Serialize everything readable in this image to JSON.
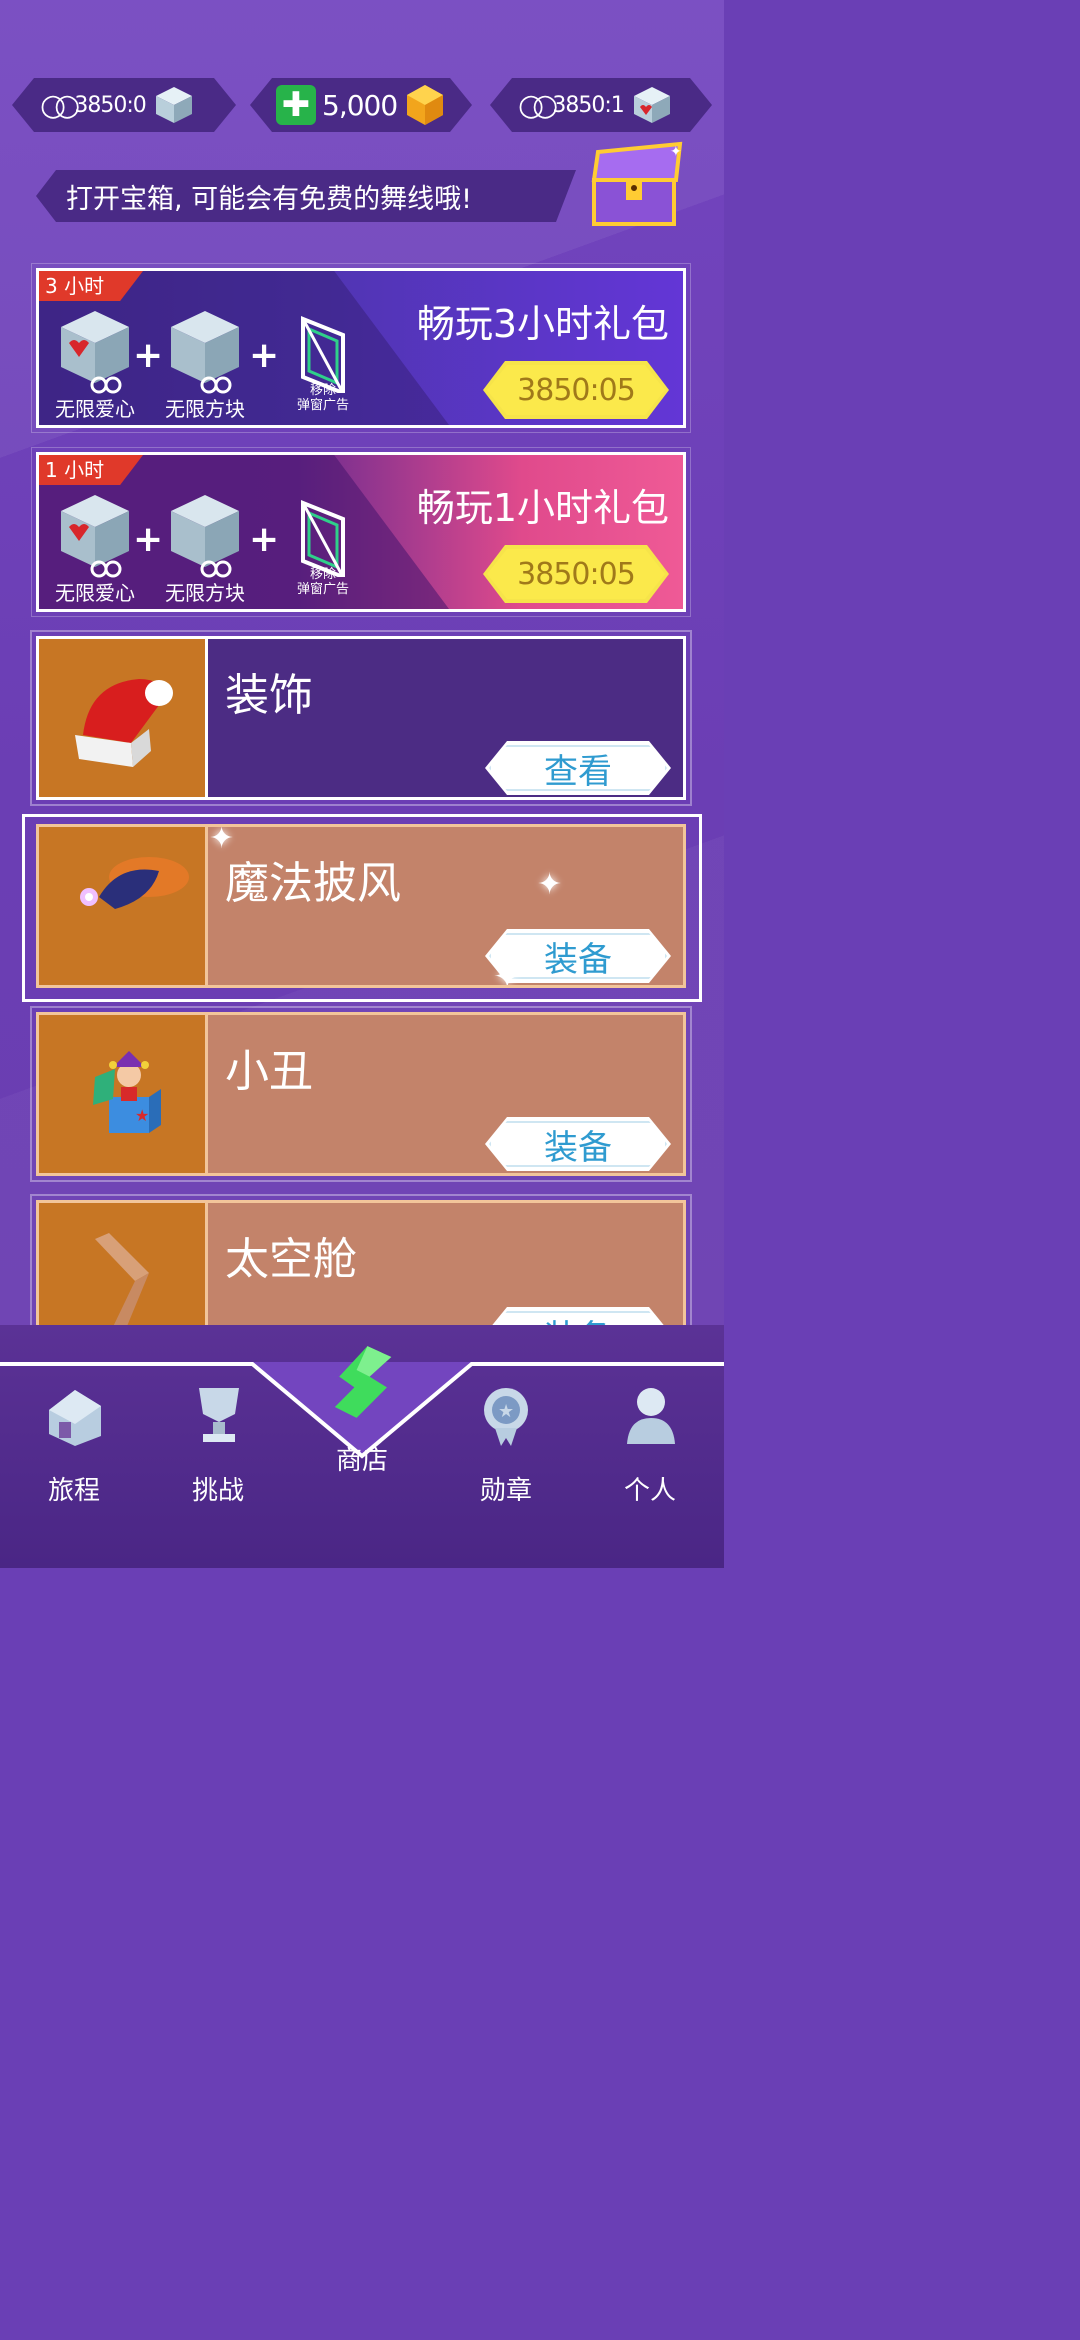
{
  "currency": {
    "hearts_timer": "3850:0",
    "gems": "5,000",
    "blocks_timer": "3850:1"
  },
  "banner": {
    "text": "打开宝箱, 可能会有免费的舞线哦!"
  },
  "bundles": [
    {
      "tag": "3 小时",
      "title": "畅玩3小时礼包",
      "price": "3850:05",
      "items": [
        "无限爱心",
        "无限方块",
        "移除\n弹窗广告"
      ]
    },
    {
      "tag": "1 小时",
      "title": "畅玩1小时礼包",
      "price": "3850:05",
      "items": [
        "无限爱心",
        "无限方块",
        "移除\n弹窗广告"
      ]
    }
  ],
  "cards": [
    {
      "name": "装饰",
      "button": "查看"
    },
    {
      "name": "魔法披风",
      "button": "装备"
    },
    {
      "name": "小丑",
      "button": "装备"
    },
    {
      "name": "太空舱",
      "button": "装备"
    }
  ],
  "nav": [
    {
      "label": "旅程",
      "icon": "house-icon"
    },
    {
      "label": "挑战",
      "icon": "trophy-icon"
    },
    {
      "label": "商店",
      "icon": "shop-s-icon"
    },
    {
      "label": "勋章",
      "icon": "medal-icon"
    },
    {
      "label": "个人",
      "icon": "profile-icon"
    }
  ],
  "colors": {
    "background": "#6a3fb5",
    "price_badge": "#f6e44a",
    "button_text": "#2f9bd0",
    "card_orange": "#c77624",
    "nav_bar": "#4a2685"
  }
}
